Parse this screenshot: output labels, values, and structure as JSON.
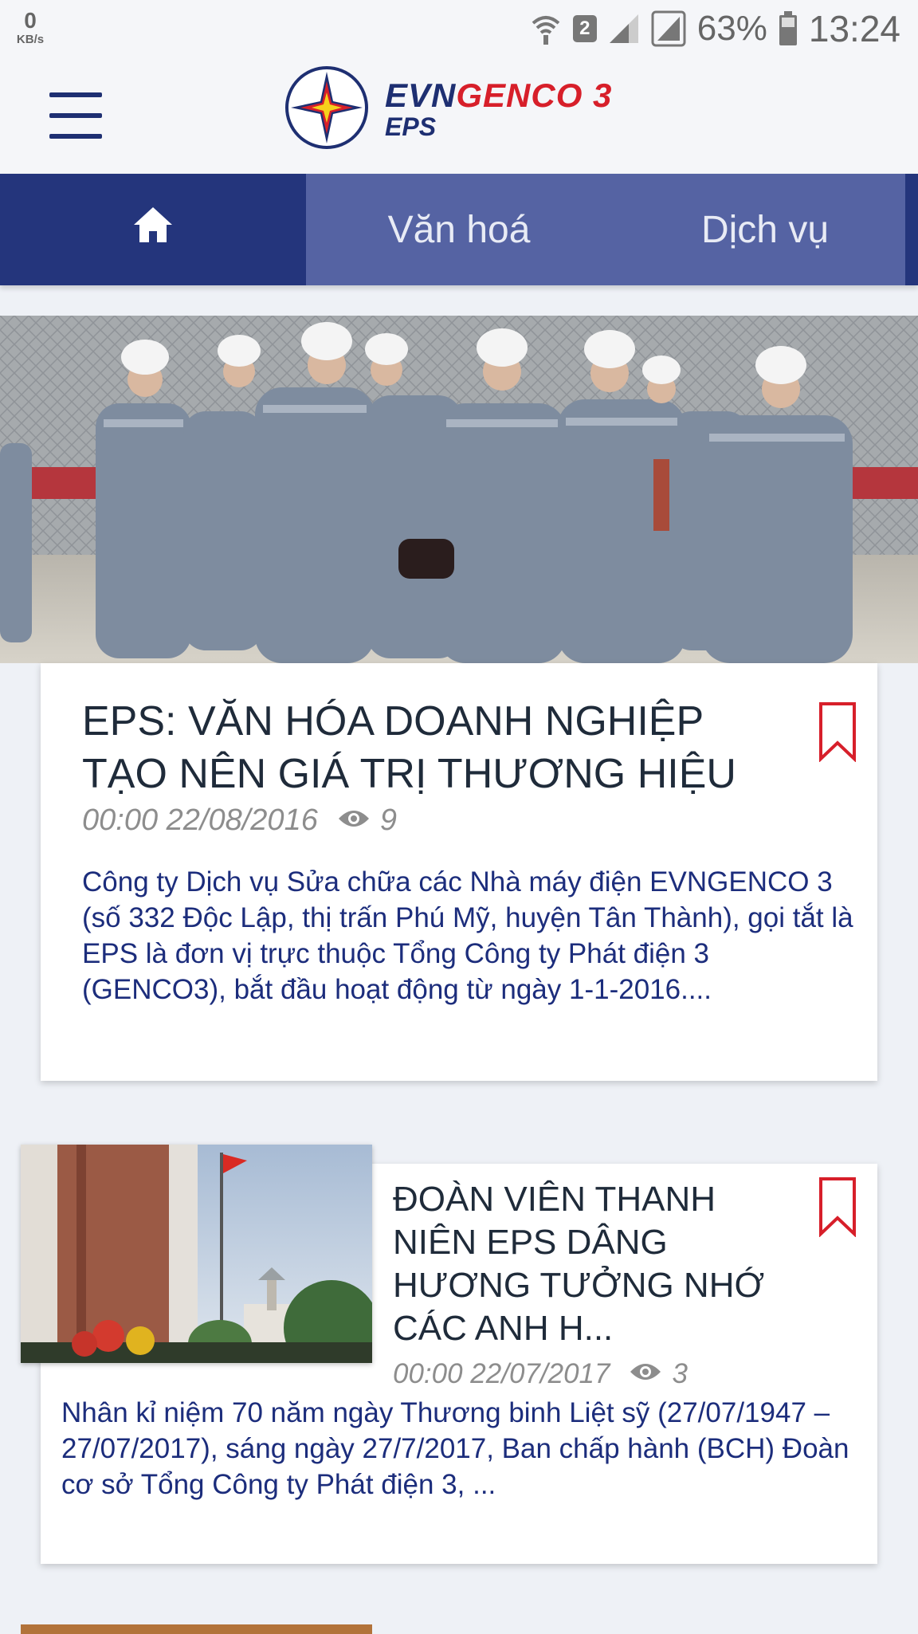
{
  "status_bar": {
    "net_speed_value": "0",
    "net_speed_unit": "KB/s",
    "sim_slot": "2",
    "battery_percent": "63%",
    "time": "13:24"
  },
  "header": {
    "brand_part1": "EVN",
    "brand_part2": "GENCO 3",
    "brand_sub": "EPS",
    "brand_colors": {
      "blue": "#1e2f72",
      "red": "#d71f2a"
    }
  },
  "tabs": [
    {
      "label": "",
      "icon": "home-icon",
      "active": true
    },
    {
      "label": "Văn hoá",
      "active": false
    },
    {
      "label": "Dịch vụ",
      "active": false
    }
  ],
  "articles": [
    {
      "title": "EPS: VĂN HÓA DOANH NGHIỆP TẠO NÊN GIÁ TRỊ THƯƠNG HIỆU",
      "datetime": "00:00 22/08/2016",
      "views": "9",
      "excerpt": "Công ty Dịch vụ Sửa chữa các Nhà máy điện EVNGENCO 3 (số 332 Độc Lập, thị trấn Phú Mỹ, huyện Tân Thành), gọi tắt là EPS là đơn vị trực thuộc Tổng Công ty Phát điện 3 (GENCO3), bắt đầu hoạt động từ ngày 1-1-2016...."
    },
    {
      "title": "ĐOÀN VIÊN THANH NIÊN EPS DÂNG HƯƠNG TƯỞNG NHỚ CÁC ANH H...",
      "datetime": "00:00 22/07/2017",
      "views": "3",
      "excerpt": "Nhân kỉ niệm 70 năm ngày Thương binh Liệt sỹ (27/07/1947 – 27/07/2017), sáng ngày 27/7/2017, Ban chấp hành (BCH) Đoàn cơ sở Tổng Công ty Phát điện 3, ..."
    }
  ],
  "colors": {
    "nav_active": "#24357c",
    "nav_bg": "#5563a3",
    "excerpt_text": "#1c2d7c",
    "bookmark": "#d71f2a"
  }
}
